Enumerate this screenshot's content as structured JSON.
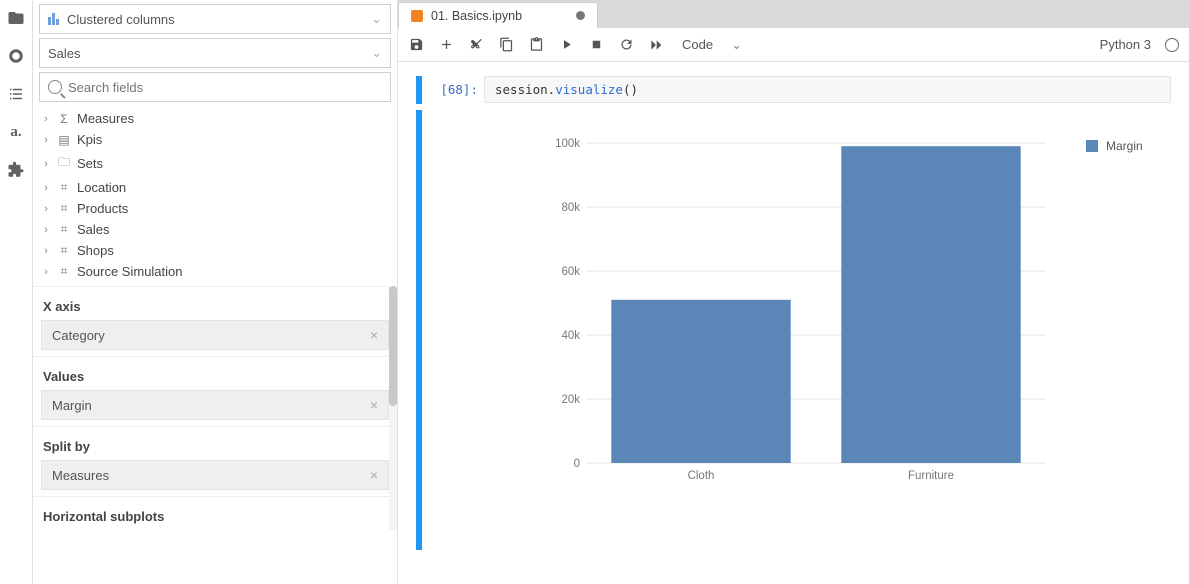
{
  "rail": {
    "icons": [
      "folder",
      "circle",
      "list",
      "atoti",
      "puzzle"
    ]
  },
  "chartSelector": {
    "label": "Clustered columns"
  },
  "cubeSelector": {
    "label": "Sales"
  },
  "search": {
    "placeholder": "Search fields"
  },
  "tree": [
    {
      "glyph": "Σ",
      "label": "Measures"
    },
    {
      "glyph": "▤",
      "label": "Kpis"
    },
    {
      "glyph": "🗀",
      "label": "Sets"
    },
    {
      "glyph": "⌗",
      "label": "Location"
    },
    {
      "glyph": "⌗",
      "label": "Products"
    },
    {
      "glyph": "⌗",
      "label": "Sales"
    },
    {
      "glyph": "⌗",
      "label": "Shops"
    },
    {
      "glyph": "⌗",
      "label": "Source Simulation"
    }
  ],
  "config": {
    "xaxis": {
      "title": "X axis",
      "chip": "Category"
    },
    "values": {
      "title": "Values",
      "chip": "Margin"
    },
    "splitby": {
      "title": "Split by",
      "chip": "Measures"
    },
    "horizsubplots": {
      "title": "Horizontal subplots"
    }
  },
  "tab": {
    "title": "01. Basics.ipynb"
  },
  "toolbar": {
    "cellType": "Code",
    "kernel": "Python 3"
  },
  "cell": {
    "prompt": "[68]:",
    "code_prefix": "session.",
    "code_method": "visualize",
    "code_suffix": "()"
  },
  "chart_data": {
    "type": "bar",
    "categories": [
      "Cloth",
      "Furniture"
    ],
    "values": [
      51000,
      99000
    ],
    "series_name": "Margin",
    "ylim": [
      0,
      100000
    ],
    "yticks": [
      0,
      20000,
      40000,
      60000,
      80000,
      100000
    ],
    "ytick_labels": [
      "0",
      "20k",
      "40k",
      "60k",
      "80k",
      "100k"
    ],
    "bar_color": "#5a87b8"
  },
  "legend": {
    "label": "Margin"
  }
}
